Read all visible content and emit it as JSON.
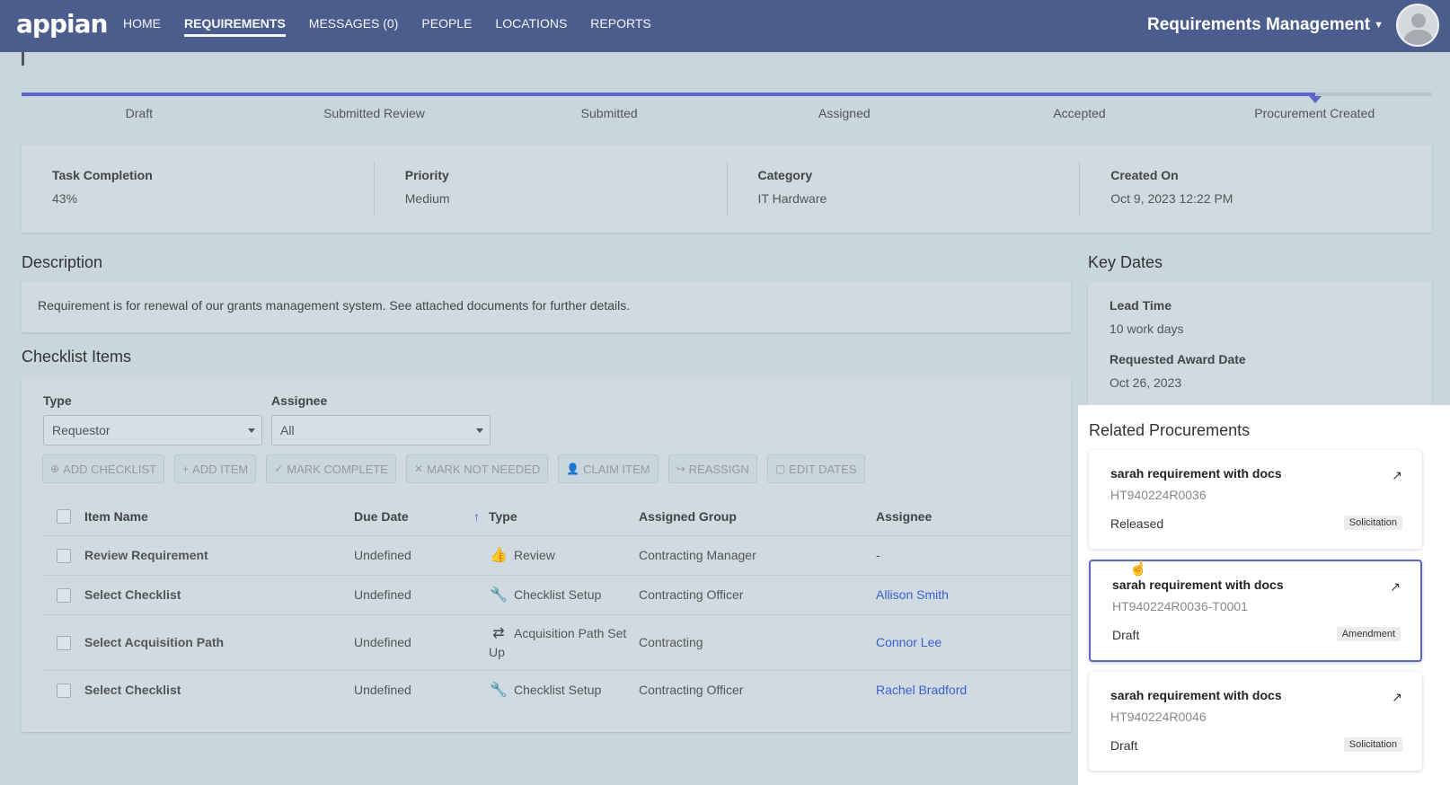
{
  "nav": {
    "logo": "appian",
    "links": [
      "HOME",
      "REQUIREMENTS",
      "MESSAGES (0)",
      "PEOPLE",
      "LOCATIONS",
      "REPORTS"
    ],
    "active": "REQUIREMENTS",
    "app_name": "Requirements Management"
  },
  "progress": {
    "steps": [
      "Draft",
      "Submitted Review",
      "Submitted",
      "Assigned",
      "Accepted",
      "Procurement Created"
    ],
    "current_step": 6,
    "fill_fraction": 0.917
  },
  "summary": [
    {
      "label": "Task Completion",
      "value": "43%"
    },
    {
      "label": "Priority",
      "value": "Medium"
    },
    {
      "label": "Category",
      "value": "IT Hardware"
    },
    {
      "label": "Created On",
      "value": "Oct 9, 2023 12:22 PM"
    }
  ],
  "description": {
    "title": "Description",
    "text": "Requirement is for renewal of our grants management system. See attached documents for further details."
  },
  "checklist": {
    "title": "Checklist Items",
    "type_label": "Type",
    "type_value": "Requestor",
    "assignee_label": "Assignee",
    "assignee_value": "All",
    "buttons": [
      "ADD CHECKLIST",
      "ADD ITEM",
      "MARK COMPLETE",
      "MARK NOT NEEDED",
      "CLAIM ITEM",
      "REASSIGN",
      "EDIT DATES"
    ],
    "columns": [
      "Item Name",
      "Due Date",
      "Type",
      "Assigned Group",
      "Assignee"
    ],
    "sort_indicator": "↑",
    "rows": [
      {
        "name": "Review Requirement",
        "due": "Undefined",
        "type": "Review",
        "type_icon": "thumbs-up-icon",
        "group": "Contracting Manager",
        "assignee": "-"
      },
      {
        "name": "Select Checklist",
        "due": "Undefined",
        "type": "Checklist Setup",
        "type_icon": "wrench-icon",
        "group": "Contracting Officer",
        "assignee": "Allison Smith"
      },
      {
        "name": "Select Acquisition Path",
        "due": "Undefined",
        "type": "Acquisition Path Set Up",
        "type_icon": "exchange-icon",
        "group": "Contracting",
        "assignee": "Connor Lee"
      },
      {
        "name": "Select Checklist",
        "due": "Undefined",
        "type": "Checklist Setup",
        "type_icon": "wrench-icon",
        "group": "Contracting Officer",
        "assignee": "Rachel Bradford"
      }
    ]
  },
  "key_dates": {
    "title": "Key Dates",
    "lead_time_label": "Lead Time",
    "lead_time_value": "10 work days",
    "award_label": "Requested Award Date",
    "award_value": "Oct 26, 2023"
  },
  "related": {
    "title": "Related Procurements",
    "cards": [
      {
        "title": "sarah requirement with docs",
        "id": "HT940224R0036",
        "status": "Released",
        "badge": "Solicitation"
      },
      {
        "title": "sarah requirement with docs",
        "id": "HT940224R0036-T0001",
        "status": "Draft",
        "badge": "Amendment"
      },
      {
        "title": "sarah requirement with docs",
        "id": "HT940224R0046",
        "status": "Draft",
        "badge": "Solicitation"
      }
    ]
  },
  "colors": {
    "nav_bg": "#4a5d8c",
    "accent": "#5b66c8",
    "page_bg": "#c9d6de",
    "link": "#3b5fd0"
  }
}
